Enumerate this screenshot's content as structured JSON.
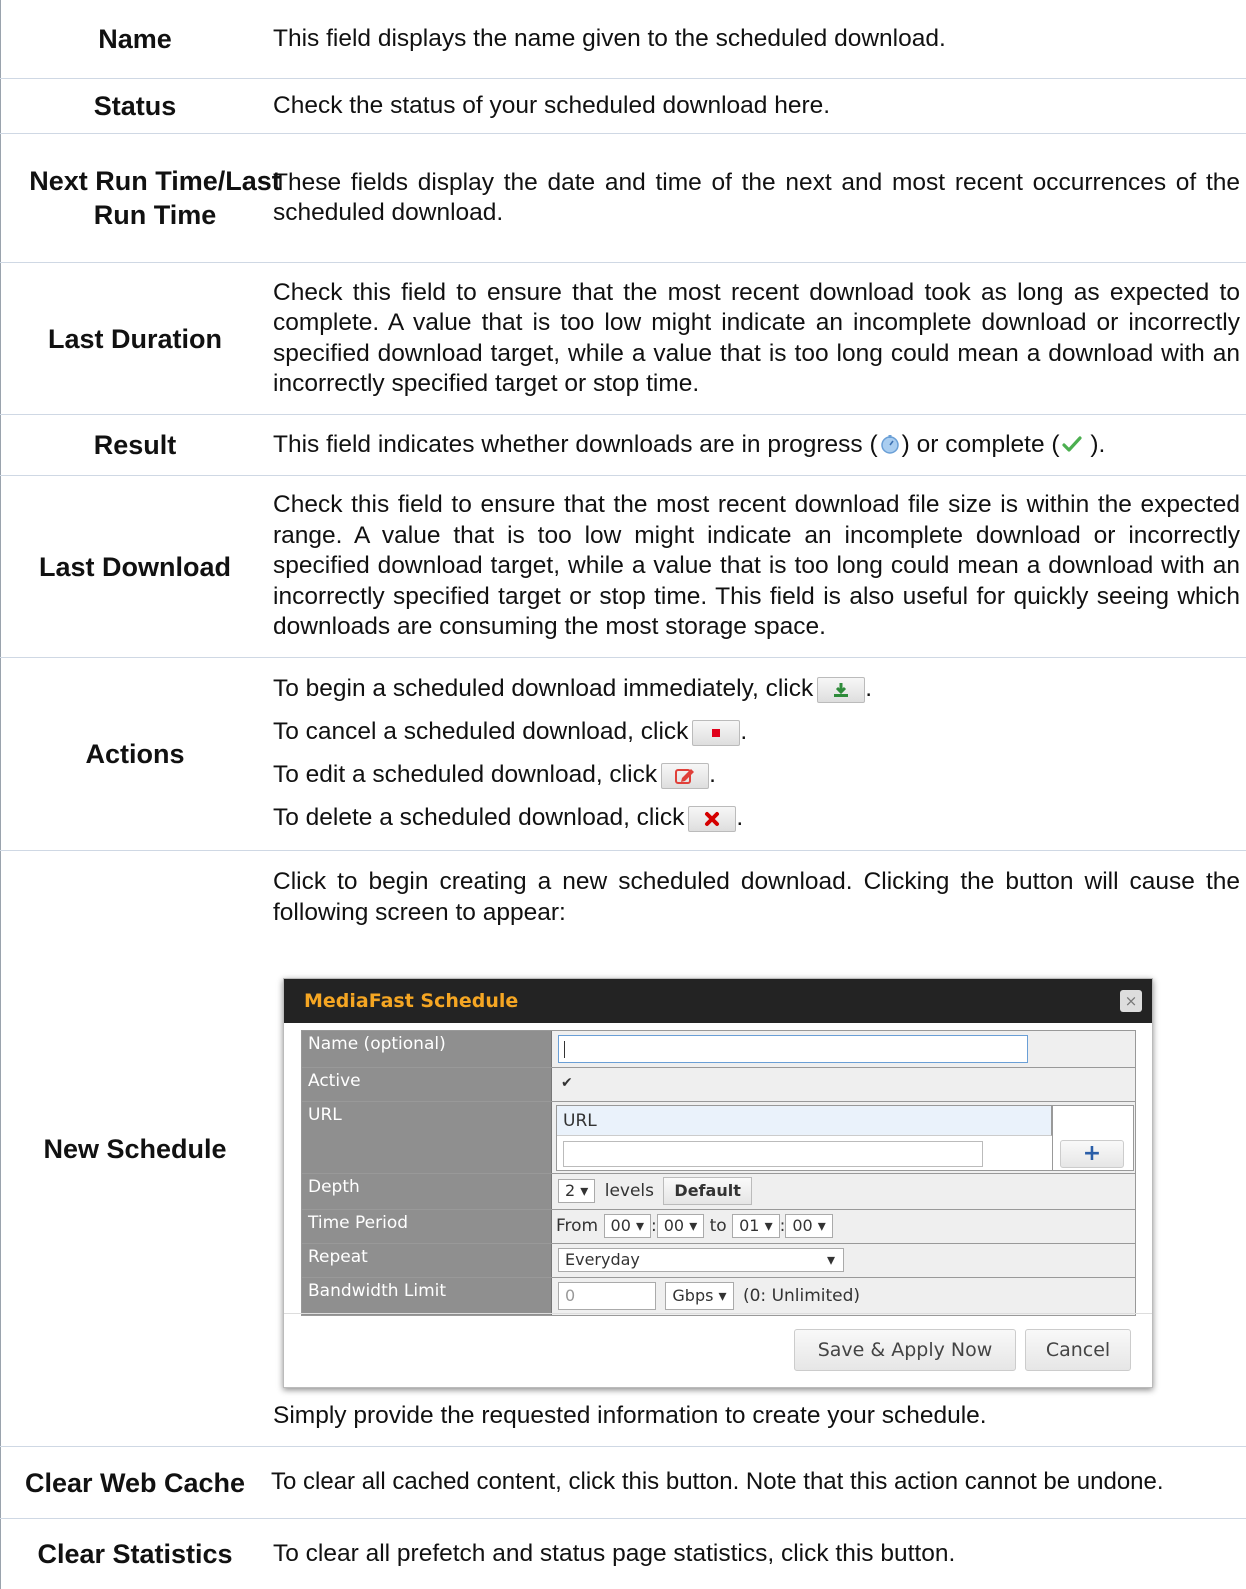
{
  "rows": [
    {
      "label": "Name",
      "desc": "This field displays the name given to the scheduled download."
    },
    {
      "label": "Status",
      "desc": "Check the status of your scheduled download here."
    },
    {
      "label": "Next Run Time/Last Run Time",
      "desc": "These fields display the date and time of the next and most recent occurrences of the scheduled download."
    },
    {
      "label": "Last Duration",
      "desc": "Check this field to ensure that the most recent download took as long as expected to complete. A value that is too low might indicate an incomplete download or incorrectly specified download target, while a value that is too long could mean a download with an incorrectly specified target or stop time."
    },
    {
      "label": "Result",
      "desc_a": "This field indicates whether downloads are in progress (",
      "desc_b": ") or complete (",
      "desc_c": " )."
    },
    {
      "label": "Last Download",
      "desc": "Check this field to ensure that the most recent download file size is within the expected range. A value that is too low might indicate an incomplete download or incorrectly specified download target, while a value that is too long could mean a download with an incorrectly specified target or stop time. This field is also useful for quickly seeing which downloads are consuming the most storage space."
    },
    {
      "label": "Actions",
      "lines": [
        "To begin a scheduled download immediately, click",
        "To cancel a scheduled download, click",
        "To edit a scheduled download, click",
        "To delete a scheduled download, click"
      ],
      "suffix": "."
    },
    {
      "label": "New Schedule",
      "desc_top": "Click to begin creating a new scheduled download. Clicking the button will cause the following screen to appear:",
      "desc_bottom": "Simply provide the requested information to create your schedule."
    },
    {
      "label": "Clear Web Cache",
      "desc": "To clear all cached content, click this button. Note that this action cannot be undone."
    },
    {
      "label": "Clear Statistics",
      "desc": "To clear all prefetch and status page statistics, click this button."
    }
  ],
  "icons": {
    "progress": "progress-clock-icon",
    "complete": "checkmark-icon",
    "start": "download-start-icon",
    "cancel": "stop-icon",
    "edit": "edit-icon",
    "delete": "delete-x-icon"
  },
  "colors": {
    "dialog_title": "#f5a623",
    "start_icon": "#2e8b3a",
    "cancel_icon": "#e0001a"
  },
  "dialog": {
    "title": "MediaFast Schedule",
    "close": "×",
    "fields": {
      "name_label": "Name (optional)",
      "active_label": "Active",
      "active_checked": "✔",
      "url_label": "URL",
      "url_column": "URL",
      "add_icon": "+",
      "depth_label": "Depth",
      "depth_value": "2",
      "depth_unit": "levels",
      "depth_default": "Default",
      "time_label": "Time Period",
      "time_from": "From",
      "from_h": "00",
      "from_m": "00",
      "time_to": "to",
      "to_h": "01",
      "to_m": "00",
      "repeat_label": "Repeat",
      "repeat_value": "Everyday",
      "bw_label": "Bandwidth Limit",
      "bw_value": "0",
      "bw_unit": "Gbps",
      "bw_note": "(0: Unlimited)"
    },
    "save": "Save & Apply Now",
    "cancel": "Cancel"
  }
}
